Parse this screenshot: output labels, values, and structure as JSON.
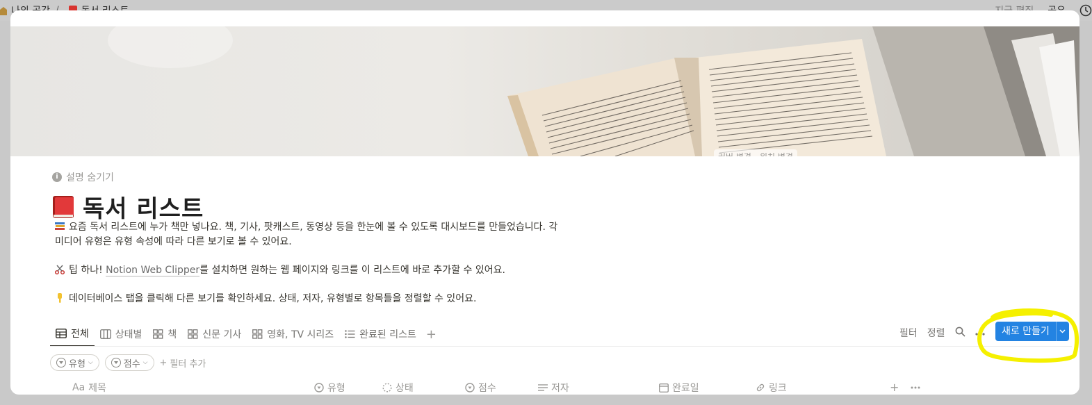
{
  "topbar": {
    "workspace": "나의 공간",
    "separator": "/",
    "page": "독서 리스트",
    "edited": "지금 편집",
    "share": "공유"
  },
  "cover": {
    "change_cover": "커버 변경",
    "reposition": "위치 변경"
  },
  "page": {
    "hide_description": "설명 숨기기",
    "title": "독서 리스트",
    "desc_line1": "요즘 독서 리스트에 누가 책만 넣나요. 책, 기사, 팟캐스트, 동영상 등을 한눈에 볼 수 있도록 대시보드를 만들었습니다. 각",
    "desc_line2": "미디어 유형은 유형 속성에 따라 다른 보기로 볼 수 있어요.",
    "tip_prefix": "팁 하나! ",
    "tip_link": "Notion Web Clipper",
    "tip_suffix": "를 설치하면 원하는 웹 페이지와 링크를 이 리스트에 바로 추가할 수 있어요.",
    "hint": "데이터베이스 탭을 클릭해 다른 보기를 확인하세요. 상태, 저자, 유형별로 항목들을 정렬할 수 있어요."
  },
  "tabs": [
    {
      "label": "전체"
    },
    {
      "label": "상태별"
    },
    {
      "label": "책"
    },
    {
      "label": "신문 기사"
    },
    {
      "label": "영화, TV 시리즈"
    },
    {
      "label": "완료된 리스트"
    }
  ],
  "toolbar": {
    "filter": "필터",
    "sort": "정렬",
    "new_label": "새로 만들기"
  },
  "filters": {
    "chip1": "유형",
    "chip2": "점수",
    "add": "필터 추가"
  },
  "columns": {
    "title_prefix": "Aa",
    "title": "제목",
    "type": "유형",
    "status": "상태",
    "score": "점수",
    "author": "저자",
    "completed": "완료일",
    "link": "링크"
  },
  "colors": {
    "accent": "#2383e2",
    "highlight": "#f5f000",
    "book": "#d8342f"
  }
}
